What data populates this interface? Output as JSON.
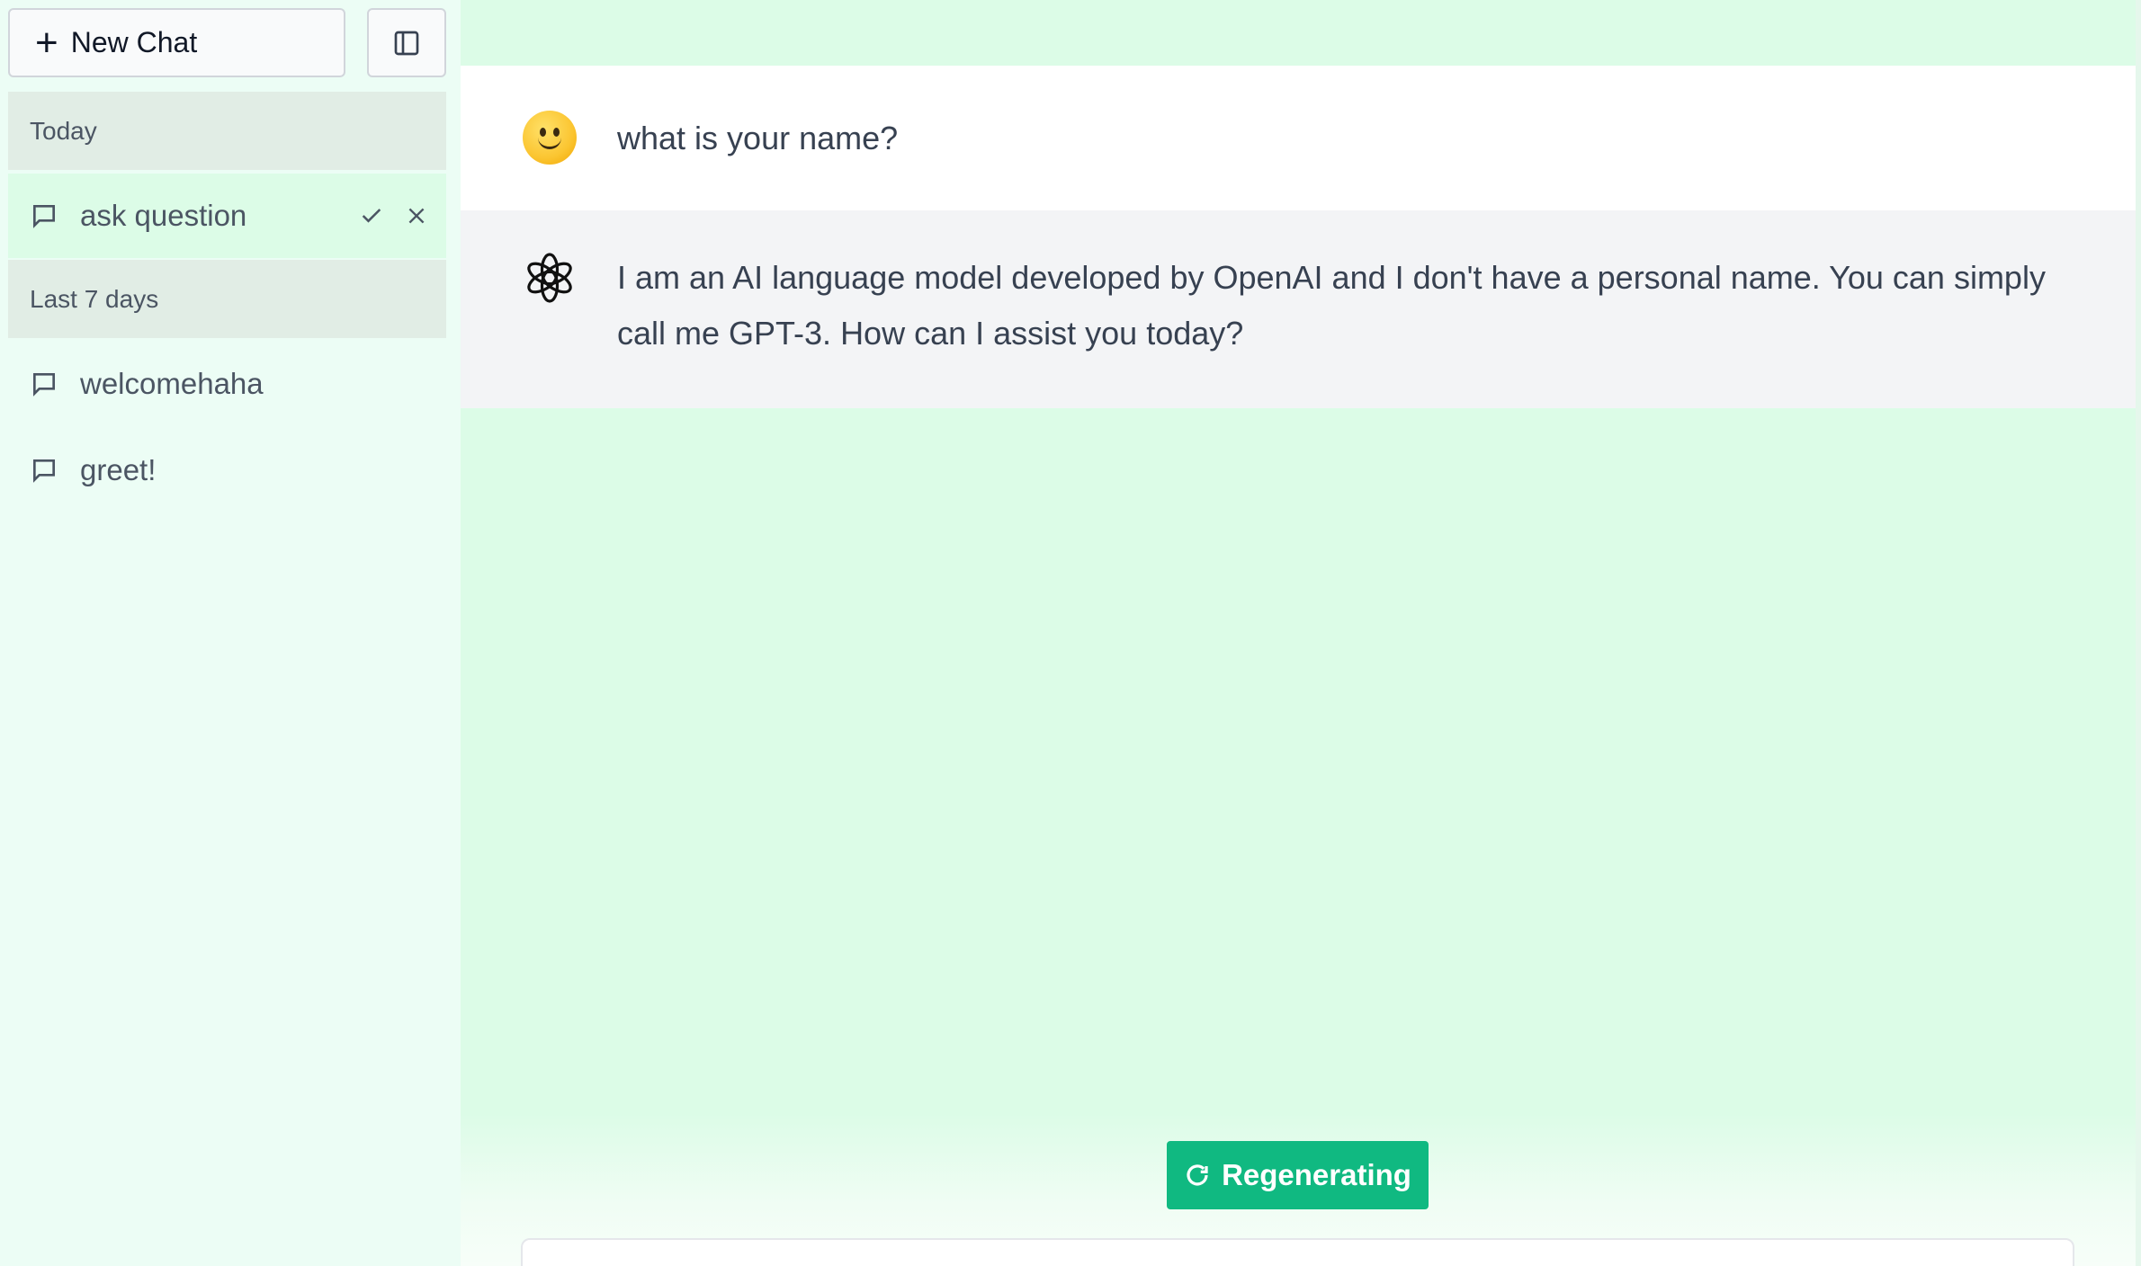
{
  "sidebar": {
    "new_chat_label": "New Chat",
    "sections": [
      {
        "label": "Today",
        "items": [
          {
            "title": "ask question",
            "active": true
          }
        ]
      },
      {
        "label": "Last 7 days",
        "items": [
          {
            "title": "welcomehaha"
          },
          {
            "title": "greet!"
          }
        ]
      }
    ]
  },
  "conversation": {
    "messages": [
      {
        "role": "user",
        "avatar": "smiley-emoji",
        "text": "what is your name?"
      },
      {
        "role": "assistant",
        "avatar": "openai-logo-icon",
        "text": "I am an AI language model developed by OpenAI and I don't have a personal name. You can simply call me GPT-3. How can I assist you today?"
      }
    ]
  },
  "footer": {
    "regenerate_label": "Regenerating"
  },
  "colors": {
    "sidebar_bg": "#ecfdf5",
    "main_bg": "#dcfce7",
    "accent": "#10b981"
  }
}
